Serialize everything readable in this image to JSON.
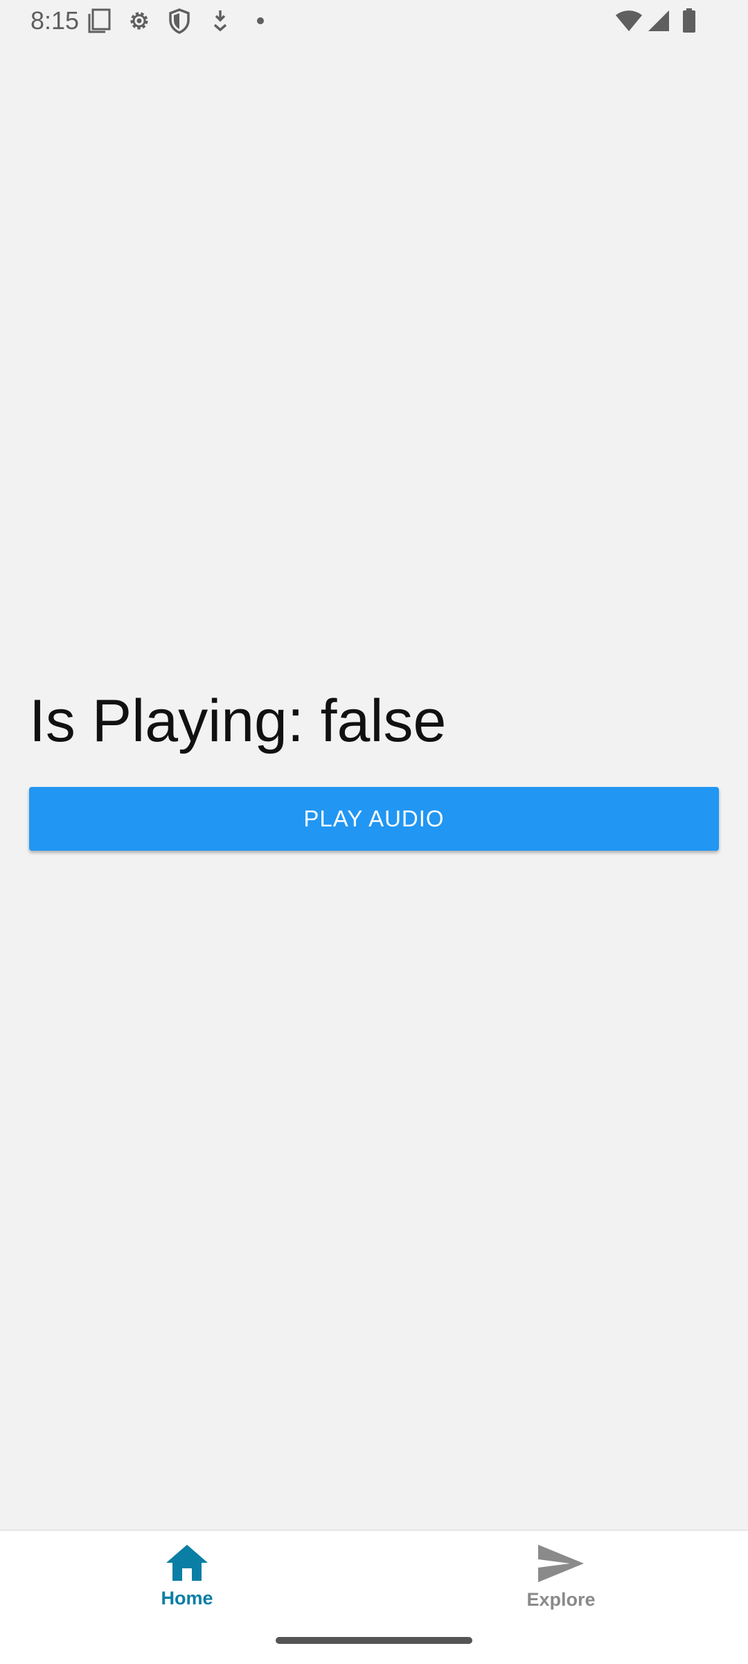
{
  "status_bar": {
    "time": "8:15",
    "left_icons": [
      "screenshot-icon",
      "settings-gear-icon",
      "shield-icon",
      "download-icon",
      "notification-dot-icon"
    ],
    "right_icons": [
      "wifi-icon",
      "cell-signal-icon",
      "battery-icon"
    ]
  },
  "main": {
    "playing_text": "Is Playing: false",
    "play_button_label": "PLAY AUDIO"
  },
  "bottom_nav": {
    "items": [
      {
        "label": "Home",
        "icon": "home-icon",
        "active": true
      },
      {
        "label": "Explore",
        "icon": "send-icon",
        "active": false
      }
    ]
  },
  "colors": {
    "background": "#f2f2f2",
    "button": "#2196f3",
    "nav_active": "#0a7ea4",
    "nav_inactive": "#8a8a8a"
  }
}
